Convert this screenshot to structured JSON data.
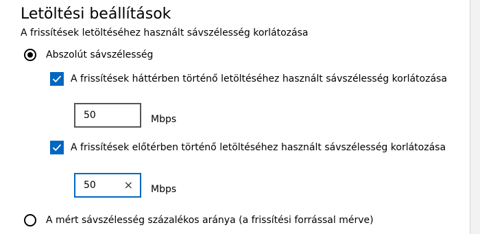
{
  "section": {
    "title": "Letöltési beállítások",
    "subtitle": "A frissítések letöltéséhez használt sávszélesség korlátozása"
  },
  "options": {
    "absolute": {
      "label": "Abszolút sávszélesség",
      "selected": true
    },
    "percentage": {
      "label": "A mért sávszélesség százalékos aránya (a frissítési forrással mérve)",
      "selected": false
    }
  },
  "background_limit": {
    "label": "A frissítések háttérben történő letöltéséhez használt sávszélesség korlátozása",
    "checked": true,
    "value": "50",
    "unit": "Mbps"
  },
  "foreground_limit": {
    "label": "A frissítések előtérben történő letöltéséhez használt sávszélesség korlátozása",
    "checked": true,
    "value": "50",
    "unit": "Mbps",
    "clear_glyph": "×"
  },
  "colors": {
    "accent": "#0067c0",
    "text": "#000000"
  },
  "icons": {
    "checkbox": "checkmark-icon",
    "clear": "close-icon"
  }
}
